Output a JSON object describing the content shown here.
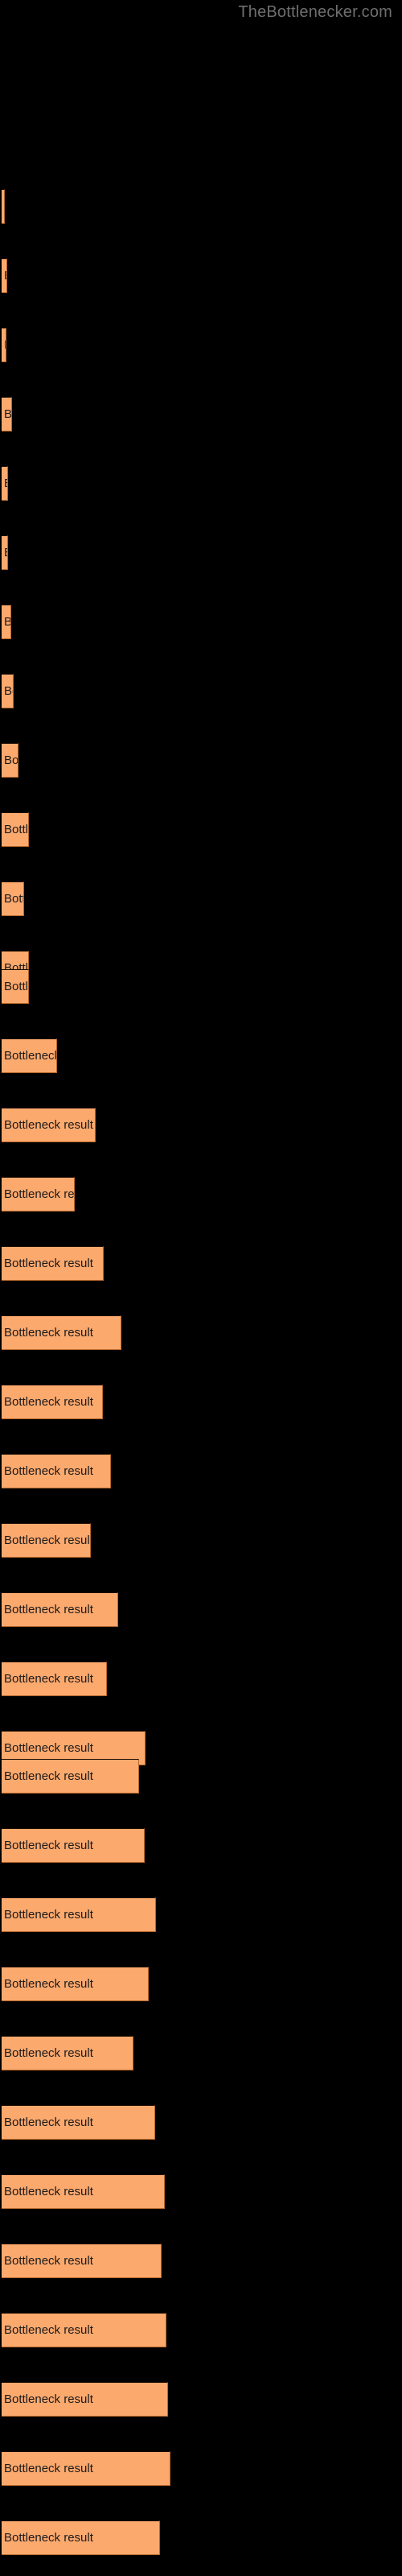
{
  "header": {
    "site_title": "TheBottlenecker.com"
  },
  "theme": {
    "background": "#000000",
    "bar_fill": "#fca96e",
    "bar_border": "#b4662a",
    "bar_top_border": "#1c0d04",
    "label_color": "#1a1a1a",
    "title_color": "#6e6e6e"
  },
  "chart_data": {
    "type": "bar",
    "orientation": "horizontal",
    "title": "",
    "subtitle": "",
    "xlabel": "",
    "ylabel": "",
    "grid": false,
    "legend": null,
    "bar_label_text": "Bottleneck result",
    "xlim": [
      0,
      500
    ],
    "categories": [
      "",
      "",
      "",
      "",
      "",
      "",
      "",
      "",
      "",
      "",
      "",
      "",
      "",
      "",
      "",
      "",
      "",
      "",
      "",
      "",
      "",
      "",
      "",
      "",
      "",
      "",
      "",
      "",
      "",
      "",
      "",
      "",
      "",
      "",
      "",
      ""
    ],
    "values": [
      4,
      7,
      6,
      13,
      8,
      8,
      12,
      15,
      21,
      34,
      28,
      34,
      34,
      69,
      117,
      91,
      127,
      149,
      126,
      136,
      111,
      145,
      131,
      179,
      171,
      178,
      192,
      183,
      164,
      191,
      203,
      199,
      205,
      207,
      210,
      197
    ],
    "bars": [
      {
        "index": 1,
        "label": "Bottleneck result",
        "value": 4,
        "top": 235
      },
      {
        "index": 2,
        "label": "Bottleneck result",
        "value": 7,
        "top": 321
      },
      {
        "index": 3,
        "label": "Bottleneck result",
        "value": 6,
        "top": 407
      },
      {
        "index": 4,
        "label": "Bottleneck result",
        "value": 13,
        "top": 493
      },
      {
        "index": 5,
        "label": "Bottleneck result",
        "value": 8,
        "top": 579
      },
      {
        "index": 6,
        "label": "Bottleneck result",
        "value": 8,
        "top": 665
      },
      {
        "index": 7,
        "label": "Bottleneck result",
        "value": 12,
        "top": 751
      },
      {
        "index": 8,
        "label": "Bottleneck result",
        "value": 15,
        "top": 837
      },
      {
        "index": 9,
        "label": "Bottleneck result",
        "value": 21,
        "top": 923
      },
      {
        "index": 10,
        "label": "Bottleneck result",
        "value": 34,
        "top": 1009
      },
      {
        "index": 11,
        "label": "Bottleneck result",
        "value": 28,
        "top": 1095
      },
      {
        "index": 12,
        "label": "Bottleneck result",
        "value": 34,
        "top": 1181
      },
      {
        "index": 13,
        "label": "Bottleneck result",
        "value": 34,
        "top": 1204
      },
      {
        "index": 14,
        "label": "Bottleneck result",
        "value": 69,
        "top": 1290
      },
      {
        "index": 15,
        "label": "Bottleneck result",
        "value": 117,
        "top": 1376
      },
      {
        "index": 16,
        "label": "Bottleneck result",
        "value": 91,
        "top": 1462
      },
      {
        "index": 17,
        "label": "Bottleneck result",
        "value": 127,
        "top": 1548
      },
      {
        "index": 18,
        "label": "Bottleneck result",
        "value": 149,
        "top": 1634
      },
      {
        "index": 19,
        "label": "Bottleneck result",
        "value": 126,
        "top": 1720
      },
      {
        "index": 20,
        "label": "Bottleneck result",
        "value": 136,
        "top": 1806
      },
      {
        "index": 21,
        "label": "Bottleneck result",
        "value": 111,
        "top": 1892
      },
      {
        "index": 22,
        "label": "Bottleneck result",
        "value": 145,
        "top": 1978
      },
      {
        "index": 23,
        "label": "Bottleneck result",
        "value": 131,
        "top": 2064
      },
      {
        "index": 24,
        "label": "Bottleneck result",
        "value": 179,
        "top": 2150
      },
      {
        "index": 25,
        "label": "Bottleneck result",
        "value": 171,
        "top": 2185
      },
      {
        "index": 26,
        "label": "Bottleneck result",
        "value": 178,
        "top": 2271
      },
      {
        "index": 27,
        "label": "Bottleneck result",
        "value": 192,
        "top": 2357
      },
      {
        "index": 28,
        "label": "Bottleneck result",
        "value": 183,
        "top": 2443
      },
      {
        "index": 29,
        "label": "Bottleneck result",
        "value": 164,
        "top": 2529
      },
      {
        "index": 30,
        "label": "Bottleneck result",
        "value": 191,
        "top": 2615
      },
      {
        "index": 31,
        "label": "Bottleneck result",
        "value": 203,
        "top": 2701
      },
      {
        "index": 32,
        "label": "Bottleneck result",
        "value": 199,
        "top": 2787
      },
      {
        "index": 33,
        "label": "Bottleneck result",
        "value": 205,
        "top": 2873
      },
      {
        "index": 34,
        "label": "Bottleneck result",
        "value": 207,
        "top": 2959
      },
      {
        "index": 35,
        "label": "Bottleneck result",
        "value": 210,
        "top": 3045
      },
      {
        "index": 36,
        "label": "Bottleneck result",
        "value": 197,
        "top": 3131
      }
    ]
  }
}
